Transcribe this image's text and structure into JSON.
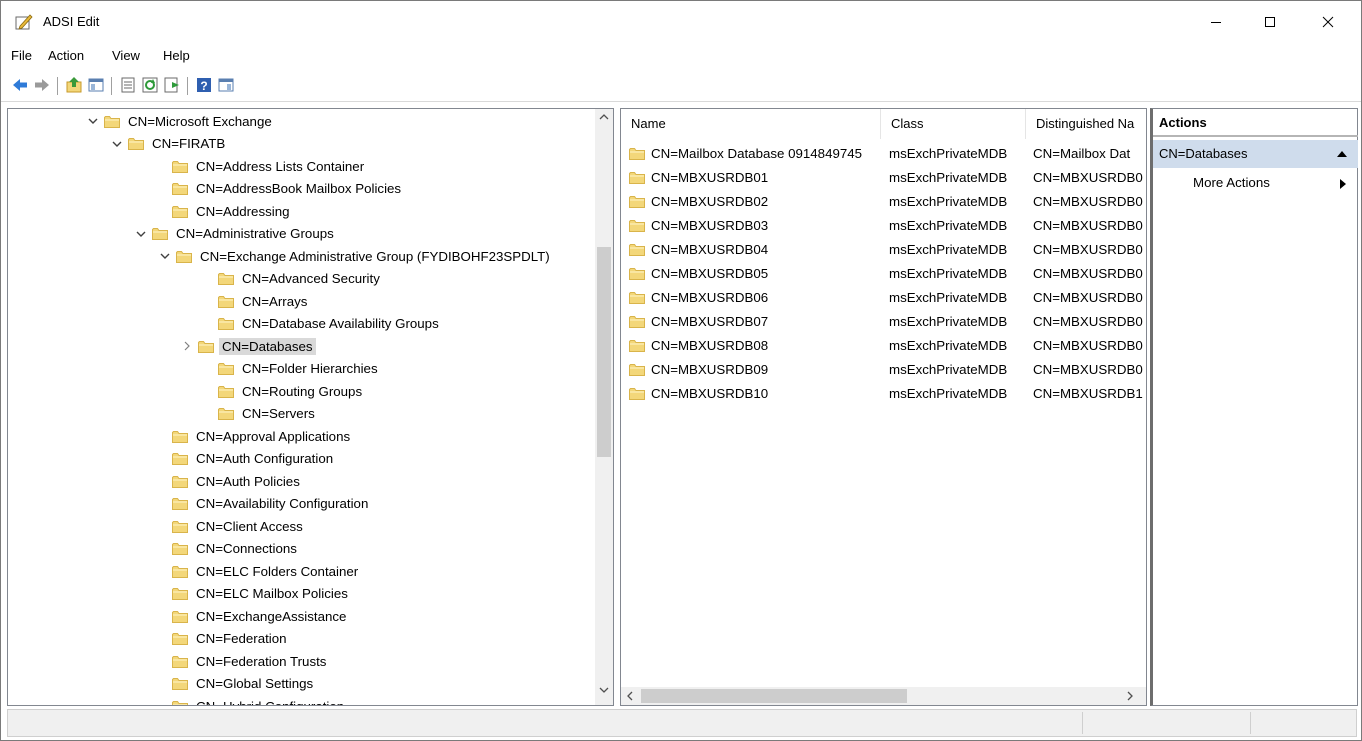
{
  "window": {
    "title": "ADSI Edit"
  },
  "menu": {
    "items": [
      "File",
      "Action",
      "View",
      "Help"
    ]
  },
  "toolbar": {
    "icons": [
      "back-icon",
      "forward-icon",
      "up-folder-icon",
      "show-hide-tree-icon",
      "properties-icon",
      "refresh-icon",
      "export-list-icon",
      "help-icon",
      "show-hide-action-pane-icon"
    ]
  },
  "tree": {
    "rows": [
      {
        "label": "CN=Microsoft Exchange",
        "expanded": "open"
      },
      {
        "label": "CN=FIRATB",
        "expanded": "open"
      },
      {
        "label": "CN=Address Lists Container",
        "expanded": "none"
      },
      {
        "label": "CN=AddressBook Mailbox Policies",
        "expanded": "none"
      },
      {
        "label": "CN=Addressing",
        "expanded": "none"
      },
      {
        "label": "CN=Administrative Groups",
        "expanded": "open"
      },
      {
        "label": "CN=Exchange Administrative Group (FYDIBOHF23SPDLT)",
        "expanded": "open"
      },
      {
        "label": "CN=Advanced Security",
        "expanded": "none"
      },
      {
        "label": "CN=Arrays",
        "expanded": "none"
      },
      {
        "label": "CN=Database Availability Groups",
        "expanded": "none"
      },
      {
        "label": "CN=Databases",
        "expanded": "closed",
        "selected": "true"
      },
      {
        "label": "CN=Folder Hierarchies",
        "expanded": "none"
      },
      {
        "label": "CN=Routing Groups",
        "expanded": "none"
      },
      {
        "label": "CN=Servers",
        "expanded": "none"
      },
      {
        "label": "CN=Approval Applications",
        "expanded": "none"
      },
      {
        "label": "CN=Auth Configuration",
        "expanded": "none"
      },
      {
        "label": "CN=Auth Policies",
        "expanded": "none"
      },
      {
        "label": "CN=Availability Configuration",
        "expanded": "none"
      },
      {
        "label": "CN=Client Access",
        "expanded": "none"
      },
      {
        "label": "CN=Connections",
        "expanded": "none"
      },
      {
        "label": "CN=ELC Folders Container",
        "expanded": "none"
      },
      {
        "label": "CN=ELC Mailbox Policies",
        "expanded": "none"
      },
      {
        "label": "CN=ExchangeAssistance",
        "expanded": "none"
      },
      {
        "label": "CN=Federation",
        "expanded": "none"
      },
      {
        "label": "CN=Federation Trusts",
        "expanded": "none"
      },
      {
        "label": "CN=Global Settings",
        "expanded": "none"
      },
      {
        "label": "CN=Hybrid Configuration",
        "expanded": "none"
      }
    ]
  },
  "list": {
    "columns": [
      "Name",
      "Class",
      "Distinguished Na"
    ],
    "rows": [
      [
        "CN=Mailbox Database 0914849745",
        "msExchPrivateMDB",
        "CN=Mailbox Dat"
      ],
      [
        "CN=MBXUSRDB01",
        "msExchPrivateMDB",
        "CN=MBXUSRDB0"
      ],
      [
        "CN=MBXUSRDB02",
        "msExchPrivateMDB",
        "CN=MBXUSRDB0"
      ],
      [
        "CN=MBXUSRDB03",
        "msExchPrivateMDB",
        "CN=MBXUSRDB0"
      ],
      [
        "CN=MBXUSRDB04",
        "msExchPrivateMDB",
        "CN=MBXUSRDB0"
      ],
      [
        "CN=MBXUSRDB05",
        "msExchPrivateMDB",
        "CN=MBXUSRDB0"
      ],
      [
        "CN=MBXUSRDB06",
        "msExchPrivateMDB",
        "CN=MBXUSRDB0"
      ],
      [
        "CN=MBXUSRDB07",
        "msExchPrivateMDB",
        "CN=MBXUSRDB0"
      ],
      [
        "CN=MBXUSRDB08",
        "msExchPrivateMDB",
        "CN=MBXUSRDB0"
      ],
      [
        "CN=MBXUSRDB09",
        "msExchPrivateMDB",
        "CN=MBXUSRDB0"
      ],
      [
        "CN=MBXUSRDB10",
        "msExchPrivateMDB",
        "CN=MBXUSRDB1"
      ]
    ]
  },
  "actions": {
    "header": "Actions",
    "section": "CN=Databases",
    "item": "More Actions"
  },
  "colors": {
    "folder": "#f3d77a",
    "folder_edge": "#d9b44a",
    "selection": "#d9d9d9",
    "action_section": "#cfdcec"
  }
}
